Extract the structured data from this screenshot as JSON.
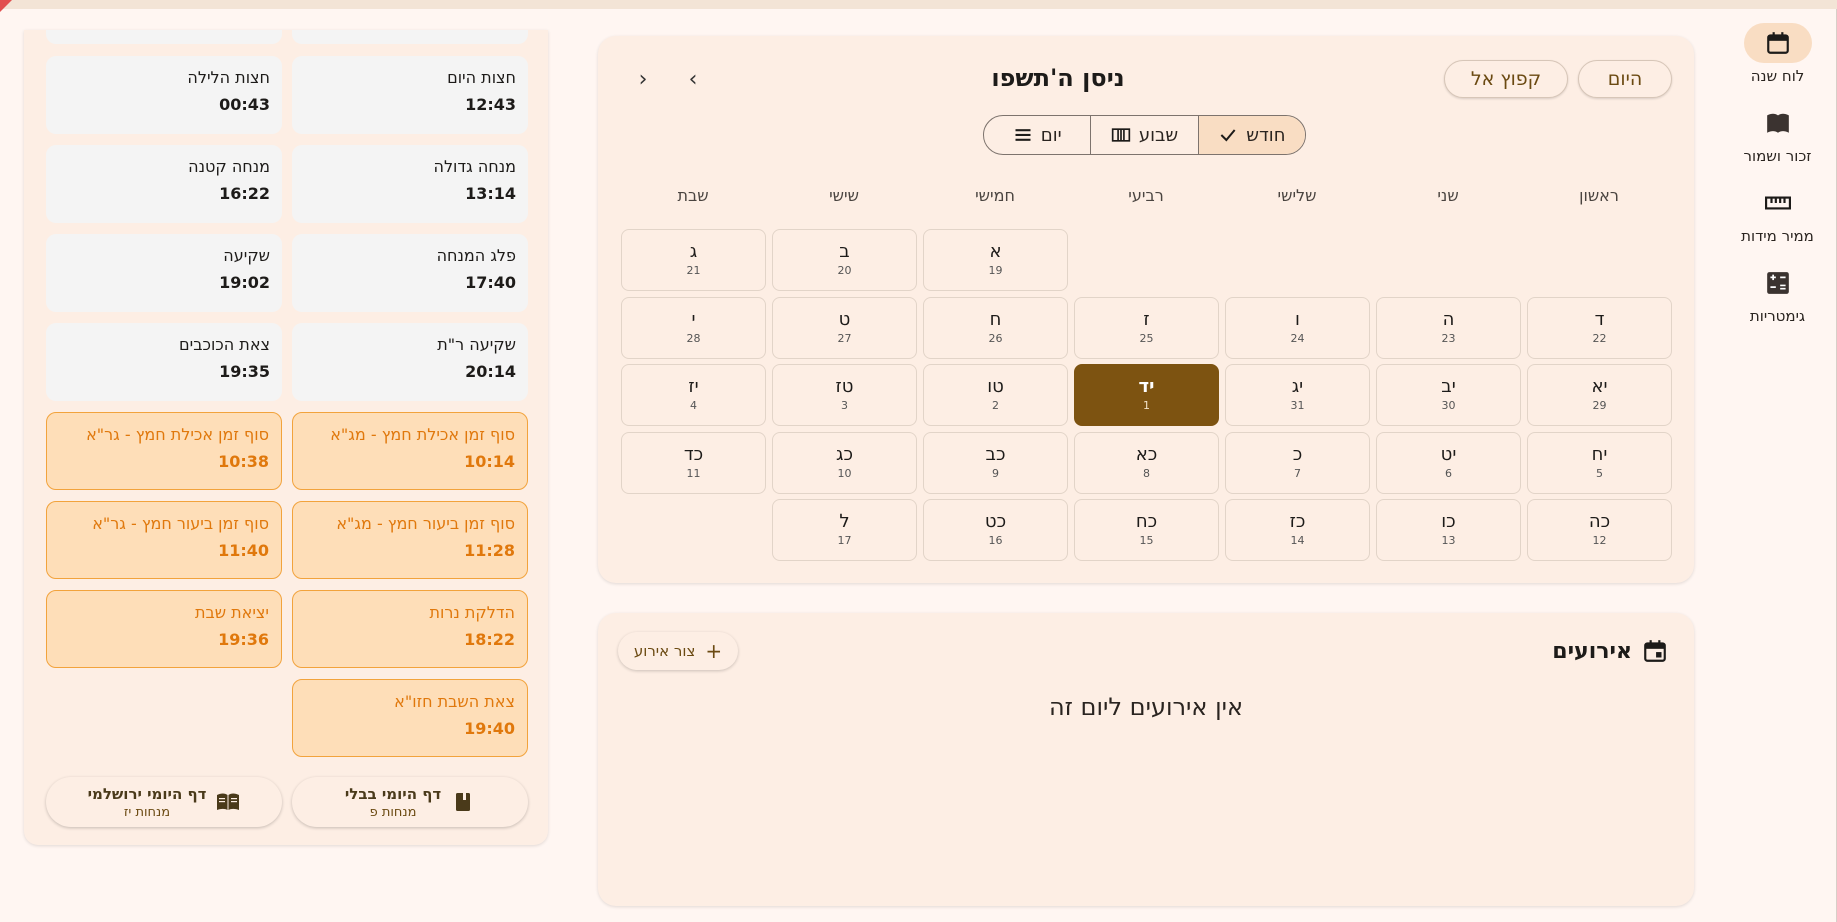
{
  "colors": {
    "accent": "#7d5311",
    "highlight_bg": "#fedeb8",
    "highlight_text": "#e0780c",
    "card_bg": "#fdeee4"
  },
  "nav": {
    "items": [
      {
        "label": "לוח שנה",
        "icon": "calendar-icon",
        "active": true
      },
      {
        "label": "זכור ושמור",
        "icon": "book-icon",
        "active": false
      },
      {
        "label": "ממיר מידות",
        "icon": "ruler-icon",
        "active": false
      },
      {
        "label": "גימטריות",
        "icon": "calculator-icon",
        "active": false
      }
    ]
  },
  "calendar": {
    "title": "ניסן ה'תשפו",
    "today_label": "היום",
    "jump_label": "קפוץ אל",
    "view_modes": [
      {
        "label": "חודש",
        "icon": "check-icon",
        "active": true
      },
      {
        "label": "שבוע",
        "icon": "week-view-icon",
        "active": false
      },
      {
        "label": "יום",
        "icon": "list-view-icon",
        "active": false
      }
    ],
    "weekdays": [
      "ראשון",
      "שני",
      "שלישי",
      "רביעי",
      "חמישי",
      "שישי",
      "שבת"
    ],
    "weeks": [
      [
        null,
        null,
        null,
        null,
        {
          "heb": "א",
          "greg": "19"
        },
        {
          "heb": "ב",
          "greg": "20"
        },
        {
          "heb": "ג",
          "greg": "21"
        }
      ],
      [
        {
          "heb": "ד",
          "greg": "22"
        },
        {
          "heb": "ה",
          "greg": "23"
        },
        {
          "heb": "ו",
          "greg": "24"
        },
        {
          "heb": "ז",
          "greg": "25"
        },
        {
          "heb": "ח",
          "greg": "26"
        },
        {
          "heb": "ט",
          "greg": "27"
        },
        {
          "heb": "י",
          "greg": "28"
        }
      ],
      [
        {
          "heb": "יא",
          "greg": "29"
        },
        {
          "heb": "יב",
          "greg": "30"
        },
        {
          "heb": "יג",
          "greg": "31"
        },
        {
          "heb": "יד",
          "greg": "1",
          "selected": true
        },
        {
          "heb": "טו",
          "greg": "2"
        },
        {
          "heb": "טז",
          "greg": "3"
        },
        {
          "heb": "יז",
          "greg": "4"
        }
      ],
      [
        {
          "heb": "יח",
          "greg": "5"
        },
        {
          "heb": "יט",
          "greg": "6"
        },
        {
          "heb": "כ",
          "greg": "7"
        },
        {
          "heb": "כא",
          "greg": "8"
        },
        {
          "heb": "כב",
          "greg": "9"
        },
        {
          "heb": "כג",
          "greg": "10"
        },
        {
          "heb": "כד",
          "greg": "11"
        }
      ],
      [
        {
          "heb": "כה",
          "greg": "12"
        },
        {
          "heb": "כו",
          "greg": "13"
        },
        {
          "heb": "כז",
          "greg": "14"
        },
        {
          "heb": "כח",
          "greg": "15"
        },
        {
          "heb": "כט",
          "greg": "16"
        },
        {
          "heb": "ל",
          "greg": "17"
        },
        null
      ]
    ]
  },
  "events": {
    "title": "אירועים",
    "add_label": "צור אירוע",
    "empty_text": "אין אירועים ליום זה"
  },
  "zmanim": [
    {
      "name": "חצות היום",
      "time": "12:43",
      "highlight": false
    },
    {
      "name": "חצות הלילה",
      "time": "00:43",
      "highlight": false
    },
    {
      "name": "מנחה גדולה",
      "time": "13:14",
      "highlight": false
    },
    {
      "name": "מנחה קטנה",
      "time": "16:22",
      "highlight": false
    },
    {
      "name": "פלג המנחה",
      "time": "17:40",
      "highlight": false
    },
    {
      "name": "שקיעה",
      "time": "19:02",
      "highlight": false
    },
    {
      "name": "שקיעה ר\"ת",
      "time": "20:14",
      "highlight": false
    },
    {
      "name": "צאת הכוכבים",
      "time": "19:35",
      "highlight": false
    },
    {
      "name": "סוף זמן אכילת חמץ - מג\"א",
      "time": "10:14",
      "highlight": true
    },
    {
      "name": "סוף זמן אכילת חמץ - גר\"א",
      "time": "10:38",
      "highlight": true
    },
    {
      "name": "סוף זמן ביעור חמץ - מג\"א",
      "time": "11:28",
      "highlight": true
    },
    {
      "name": "סוף זמן ביעור חמץ - גר\"א",
      "time": "11:40",
      "highlight": true
    },
    {
      "name": "הדלקת נרות",
      "time": "18:22",
      "highlight": true
    },
    {
      "name": "יציאת שבת",
      "time": "19:36",
      "highlight": true
    },
    {
      "name": "צאת השבת חזו\"א",
      "time": "19:40",
      "highlight": true
    }
  ],
  "daf_yomi": [
    {
      "title": "דף היומי בבלי",
      "sub": "מנחות פ",
      "icon": "book-closed-icon"
    },
    {
      "title": "דף היומי ירושלמי",
      "sub": "מנחות יז",
      "icon": "book-open-icon"
    }
  ]
}
